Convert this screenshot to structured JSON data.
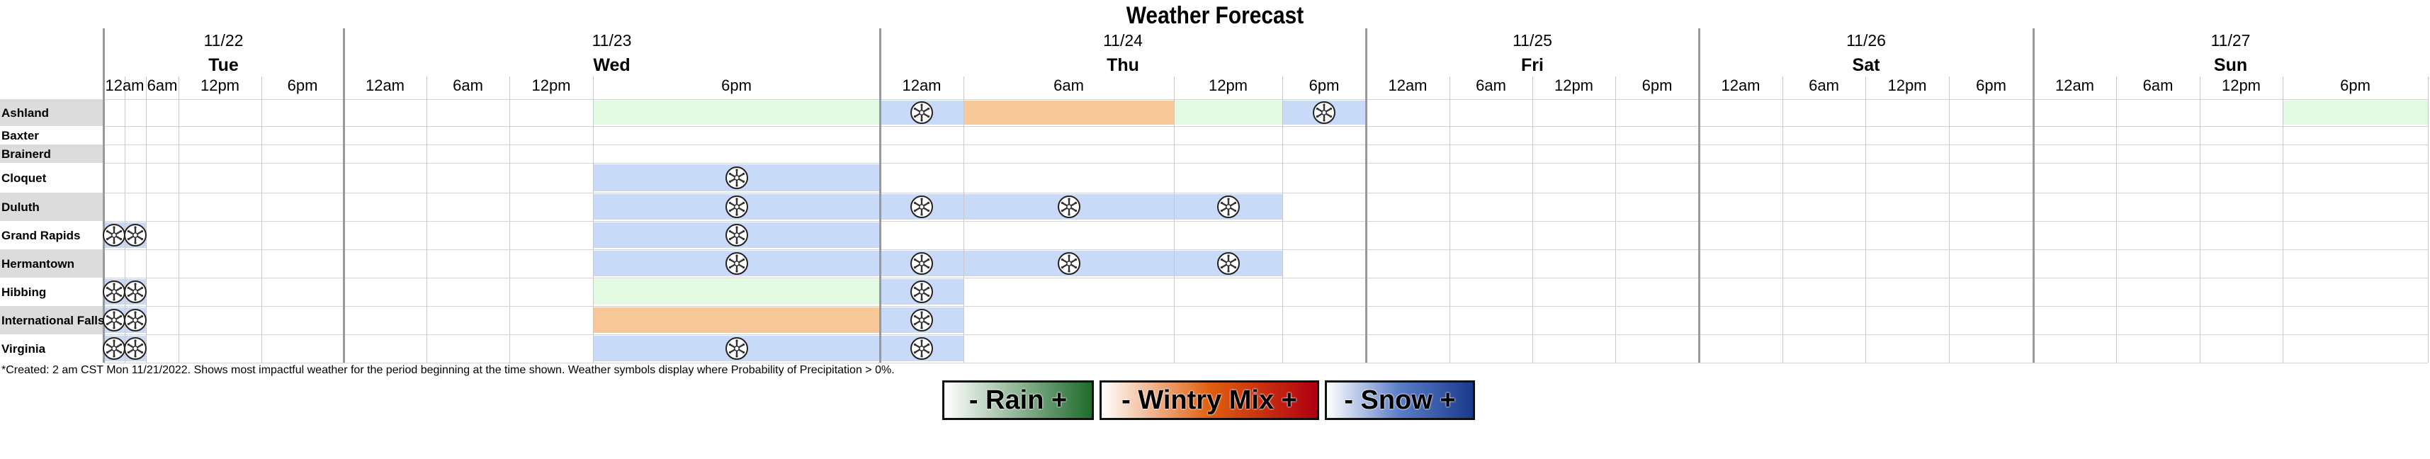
{
  "title": "Weather Forecast",
  "footnote": "*Created: 2 am CST Mon 11/21/2022. Shows most impactful weather for the period beginning at the time shown. Weather symbols display where Probability of Precipitation > 0%.",
  "colors": {
    "rain": "#e2fae2",
    "wintry_mix": "#f8c89a",
    "snow": "#c9daf8",
    "row_label_shade": "#dcdcdc"
  },
  "legend": [
    {
      "key": "rain",
      "label": "- Rain +",
      "gradient": [
        "#ffffff",
        "#1f6b2c"
      ]
    },
    {
      "key": "wintry_mix",
      "label": "- Wintry Mix +",
      "gradient": [
        "#ffffff",
        "#e06010",
        "#b00010"
      ]
    },
    {
      "key": "snow",
      "label": "- Snow +",
      "gradient": [
        "#ffffff",
        "#5a7dc8",
        "#1a3a8a"
      ]
    }
  ],
  "chart_data": {
    "type": "table",
    "days": [
      {
        "date": "11/22",
        "day": "Tue",
        "periods": [
          "12am",
          "6am",
          "12pm",
          "6pm"
        ]
      },
      {
        "date": "11/23",
        "day": "Wed",
        "periods": [
          "12am",
          "6am",
          "12pm",
          "6pm"
        ]
      },
      {
        "date": "11/24",
        "day": "Thu",
        "periods": [
          "12am",
          "6am",
          "12pm",
          "6pm"
        ]
      },
      {
        "date": "11/25",
        "day": "Fri",
        "periods": [
          "12am",
          "6am",
          "12pm",
          "6pm"
        ]
      },
      {
        "date": "11/26",
        "day": "Sat",
        "periods": [
          "12am",
          "6am",
          "12pm",
          "6pm"
        ]
      },
      {
        "date": "11/27",
        "day": "Sun",
        "periods": [
          "12am",
          "6am",
          "12pm",
          "6pm"
        ]
      }
    ],
    "locations": [
      "Ashland",
      "Baxter",
      "Brainerd",
      "Cloquet",
      "Duluth",
      "Grand Rapids",
      "Hermantown",
      "Hibbing",
      "International Falls",
      "Virginia"
    ],
    "cells": [
      {
        "location": "Ashland",
        "date": "11/23",
        "from": "6pm",
        "to": "12am",
        "type": "rain",
        "symbol": false
      },
      {
        "location": "Ashland",
        "date": "11/24",
        "from": "12am",
        "to": "6am",
        "type": "snow",
        "symbol": true
      },
      {
        "location": "Ashland",
        "date": "11/24",
        "from": "6am",
        "to": "12pm",
        "type": "wintry_mix",
        "symbol": false
      },
      {
        "location": "Ashland",
        "date": "11/24",
        "from": "12pm",
        "to": "6pm",
        "type": "rain",
        "symbol": false
      },
      {
        "location": "Ashland",
        "date": "11/24",
        "from": "6pm",
        "to": "12am",
        "type": "snow",
        "symbol": true
      },
      {
        "location": "Ashland",
        "date": "11/27",
        "from": "6pm",
        "to": "12am",
        "type": "rain",
        "symbol": false
      },
      {
        "location": "Cloquet",
        "date": "11/23",
        "from": "6pm",
        "to": "12am",
        "type": "snow",
        "symbol": true
      },
      {
        "location": "Duluth",
        "date": "11/23",
        "from": "6pm",
        "to": "12am",
        "type": "snow",
        "symbol": true
      },
      {
        "location": "Duluth",
        "date": "11/24",
        "from": "12am",
        "to": "6am",
        "type": "snow",
        "symbol": true
      },
      {
        "location": "Duluth",
        "date": "11/24",
        "from": "6am",
        "to": "12pm",
        "type": "snow",
        "symbol": true
      },
      {
        "location": "Duluth",
        "date": "11/24",
        "from": "12pm",
        "to": "6pm",
        "type": "snow",
        "symbol": true
      },
      {
        "location": "Grand Rapids",
        "date": "11/22",
        "from": "12am",
        "to": "3am",
        "type": "snow",
        "symbol": true
      },
      {
        "location": "Grand Rapids",
        "date": "11/22",
        "from": "3am",
        "to": "6am",
        "type": "snow",
        "symbol": true
      },
      {
        "location": "Grand Rapids",
        "date": "11/23",
        "from": "6pm",
        "to": "12am",
        "type": "snow",
        "symbol": true
      },
      {
        "location": "Hermantown",
        "date": "11/23",
        "from": "6pm",
        "to": "12am",
        "type": "snow",
        "symbol": true
      },
      {
        "location": "Hermantown",
        "date": "11/24",
        "from": "12am",
        "to": "6am",
        "type": "snow",
        "symbol": true
      },
      {
        "location": "Hermantown",
        "date": "11/24",
        "from": "6am",
        "to": "12pm",
        "type": "snow",
        "symbol": true
      },
      {
        "location": "Hermantown",
        "date": "11/24",
        "from": "12pm",
        "to": "6pm",
        "type": "snow",
        "symbol": true
      },
      {
        "location": "Hibbing",
        "date": "11/22",
        "from": "12am",
        "to": "3am",
        "type": "snow",
        "symbol": true
      },
      {
        "location": "Hibbing",
        "date": "11/22",
        "from": "3am",
        "to": "6am",
        "type": "snow",
        "symbol": true
      },
      {
        "location": "Hibbing",
        "date": "11/23",
        "from": "6pm",
        "to": "12am",
        "type": "rain",
        "symbol": false
      },
      {
        "location": "Hibbing",
        "date": "11/24",
        "from": "12am",
        "to": "6am",
        "type": "snow",
        "symbol": true
      },
      {
        "location": "International Falls",
        "date": "11/22",
        "from": "12am",
        "to": "3am",
        "type": "snow",
        "symbol": true
      },
      {
        "location": "International Falls",
        "date": "11/22",
        "from": "3am",
        "to": "6am",
        "type": "snow",
        "symbol": true
      },
      {
        "location": "International Falls",
        "date": "11/23",
        "from": "6pm",
        "to": "12am",
        "type": "wintry_mix",
        "symbol": false
      },
      {
        "location": "International Falls",
        "date": "11/24",
        "from": "12am",
        "to": "6am",
        "type": "snow",
        "symbol": true
      },
      {
        "location": "Virginia",
        "date": "11/22",
        "from": "12am",
        "to": "3am",
        "type": "snow",
        "symbol": true
      },
      {
        "location": "Virginia",
        "date": "11/22",
        "from": "3am",
        "to": "6am",
        "type": "snow",
        "symbol": true
      },
      {
        "location": "Virginia",
        "date": "11/23",
        "from": "6pm",
        "to": "12am",
        "type": "snow",
        "symbol": true
      },
      {
        "location": "Virginia",
        "date": "11/24",
        "from": "12am",
        "to": "6am",
        "type": "snow",
        "symbol": true
      }
    ]
  }
}
